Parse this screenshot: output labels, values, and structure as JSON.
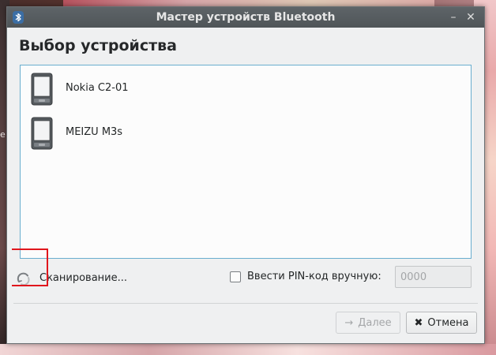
{
  "desktop": {
    "edge_text": "e"
  },
  "window": {
    "title": "Мастер устройств Bluetooth",
    "minimize_glyph": "–",
    "close_glyph": "✕",
    "app_icon": "bluetooth-icon"
  },
  "page": {
    "heading": "Выбор устройства"
  },
  "devices": [
    {
      "name": "Nokia C2-01",
      "icon": "phone-icon"
    },
    {
      "name": "MEIZU M3s",
      "icon": "phone-icon"
    }
  ],
  "scan": {
    "label": "Сканирование...",
    "icon": "refresh-spinner-icon"
  },
  "pin": {
    "checkbox_label": "Ввести PIN-код вручную:",
    "checked": false,
    "value": "0000"
  },
  "buttons": {
    "next_label": "Далее",
    "next_icon": "→",
    "cancel_label": "Отмена",
    "cancel_icon": "✖"
  },
  "colors": {
    "accent": "#6aaecf",
    "highlight": "#e0161d"
  }
}
